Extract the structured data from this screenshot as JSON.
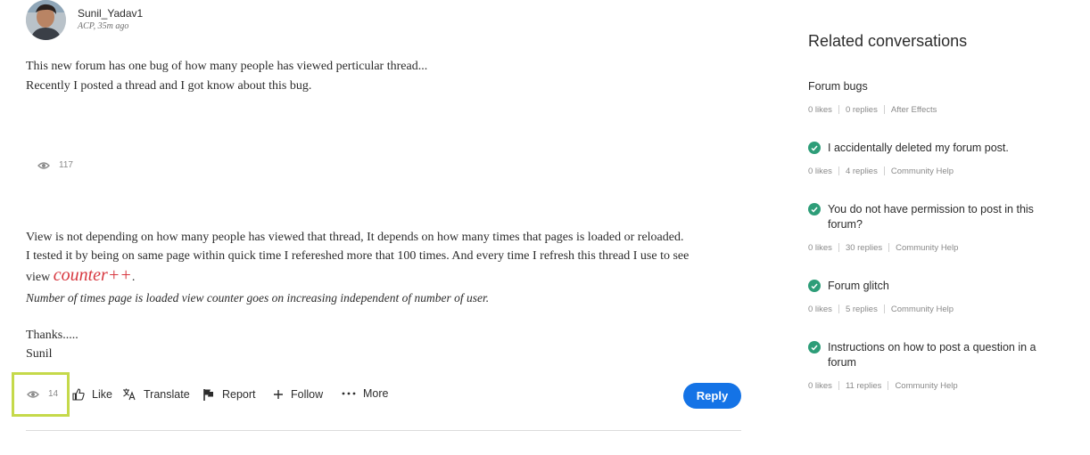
{
  "post": {
    "author": "Sunil_Yadav1",
    "meta": "ACP, 35m ago",
    "paragraph1": [
      "This new forum has one bug of how many people has viewed perticular thread...",
      "Recently I posted a thread and I got know about this bug."
    ],
    "embedded_views": "117",
    "paragraph2": [
      "View is not depending on how many people has viewed that thread, It depends on how many times that pages is loaded or reloaded.",
      "I tested it by being on same page within quick time I refereshed more that 100 times. And every time I refresh this thread I use to see"
    ],
    "line3_prefix": "view",
    "counter_text": "counter++",
    "line3_suffix": ".",
    "note": "Number of times page is loaded view counter goes on increasing independent of number of user.",
    "closing": [
      "Thanks.....",
      "Sunil"
    ],
    "views": "14",
    "actions": {
      "like": "Like",
      "translate": "Translate",
      "report": "Report",
      "follow": "Follow",
      "more": "More",
      "reply": "Reply"
    },
    "colors": {
      "counter": "#d7373f",
      "reply": "#1473e6",
      "highlight": "#c5d94a",
      "resolved": "#2d9d78"
    }
  },
  "related": {
    "title": "Related conversations",
    "items": [
      {
        "title": "Forum bugs",
        "resolved": false,
        "likes": "0 likes",
        "replies": "0 replies",
        "forum": "After Effects"
      },
      {
        "title": "I accidentally deleted my forum post.",
        "resolved": true,
        "likes": "0 likes",
        "replies": "4 replies",
        "forum": "Community Help"
      },
      {
        "title": "You do not have permission to post in this forum?",
        "resolved": true,
        "likes": "0 likes",
        "replies": "30 replies",
        "forum": "Community Help"
      },
      {
        "title": "Forum glitch",
        "resolved": true,
        "likes": "0 likes",
        "replies": "5 replies",
        "forum": "Community Help"
      },
      {
        "title": "Instructions on how to post a question in a forum",
        "resolved": true,
        "likes": "0 likes",
        "replies": "11 replies",
        "forum": "Community Help"
      }
    ]
  }
}
